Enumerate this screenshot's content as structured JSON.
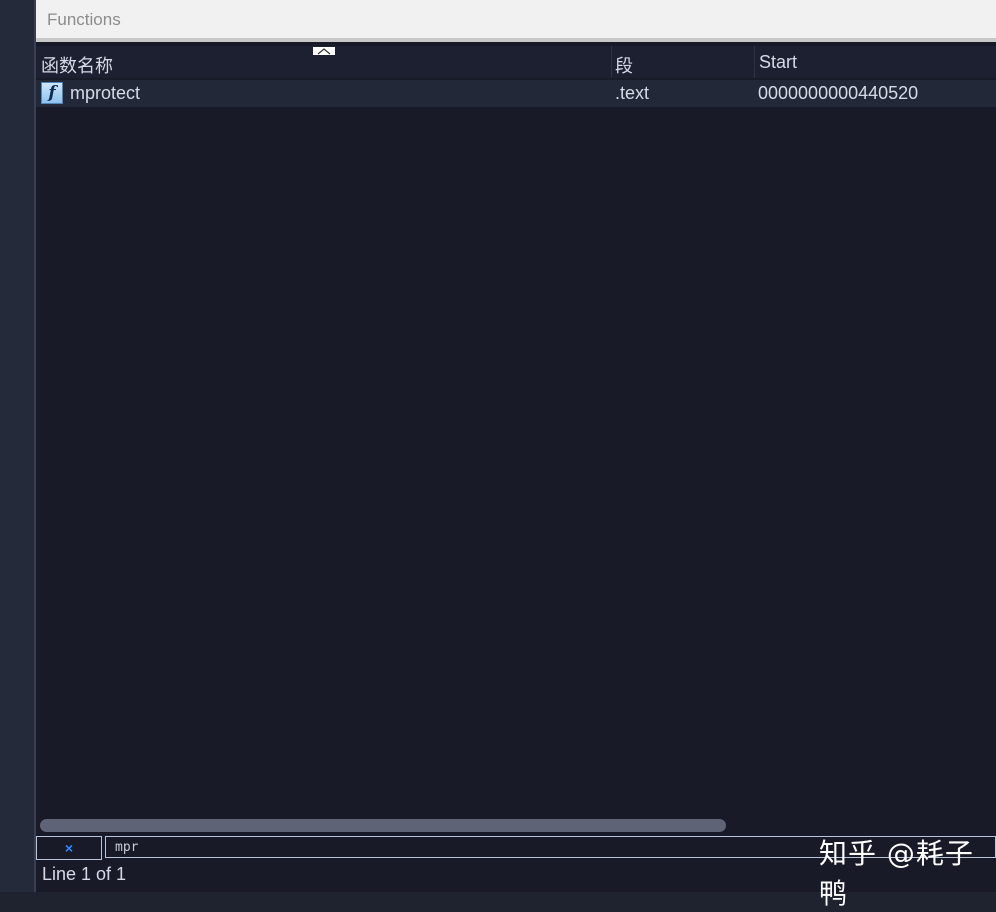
{
  "window": {
    "title": "Functions"
  },
  "table": {
    "columns": [
      "函数名称",
      "段",
      "Start"
    ],
    "rows": [
      {
        "icon": "function-icon",
        "icon_glyph": "f",
        "name": "mprotect",
        "segment": ".text",
        "start": "0000000000440520"
      }
    ]
  },
  "filter": {
    "clear_glyph": "×",
    "value": "mpr"
  },
  "status": {
    "text": "Line 1 of 1"
  },
  "watermark": {
    "text": "知乎 @耗子鸭"
  },
  "colors": {
    "background": "#181b27",
    "titlebar": "#f1f1f1",
    "accent": "#2a8cff",
    "selected_row": "#232838"
  }
}
